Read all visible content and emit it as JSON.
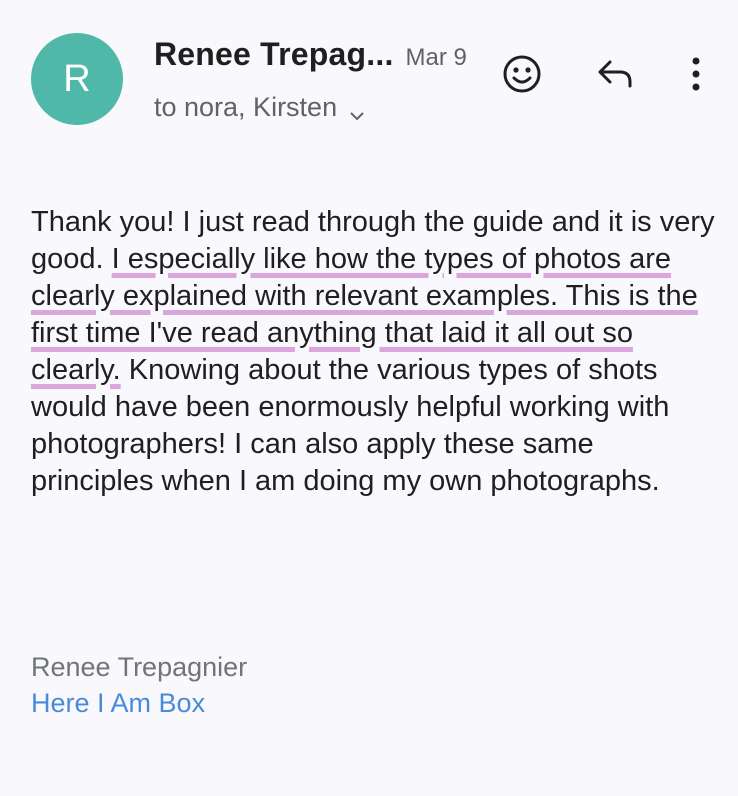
{
  "header": {
    "avatar_letter": "R",
    "avatar_color": "#4fb8a8",
    "sender_name": "Renee Trepag...",
    "date": "Mar 9",
    "recipients": "to nora, Kirsten"
  },
  "message": {
    "part1": "Thank you! I just read through the guide and it is very good. ",
    "highlighted": "I especially like how the types of photos are clearly explained with relevant examples. This is the first time I've read anything that laid it all out so clearly.",
    "part2": " Knowing  about the various types of shots would have been enormously helpful working with photographers! I can also apply these same principles when I am doing my own photographs.",
    "highlight_color": "#d9a6dd"
  },
  "signature": {
    "name": "Renee Trepagnier",
    "link_text": "Here I Am Box",
    "link_color": "#4a8bd9"
  },
  "icons": {
    "emoji": "smiley-icon",
    "reply": "reply-icon",
    "more": "more-vert-icon",
    "expand": "chevron-down-icon"
  }
}
